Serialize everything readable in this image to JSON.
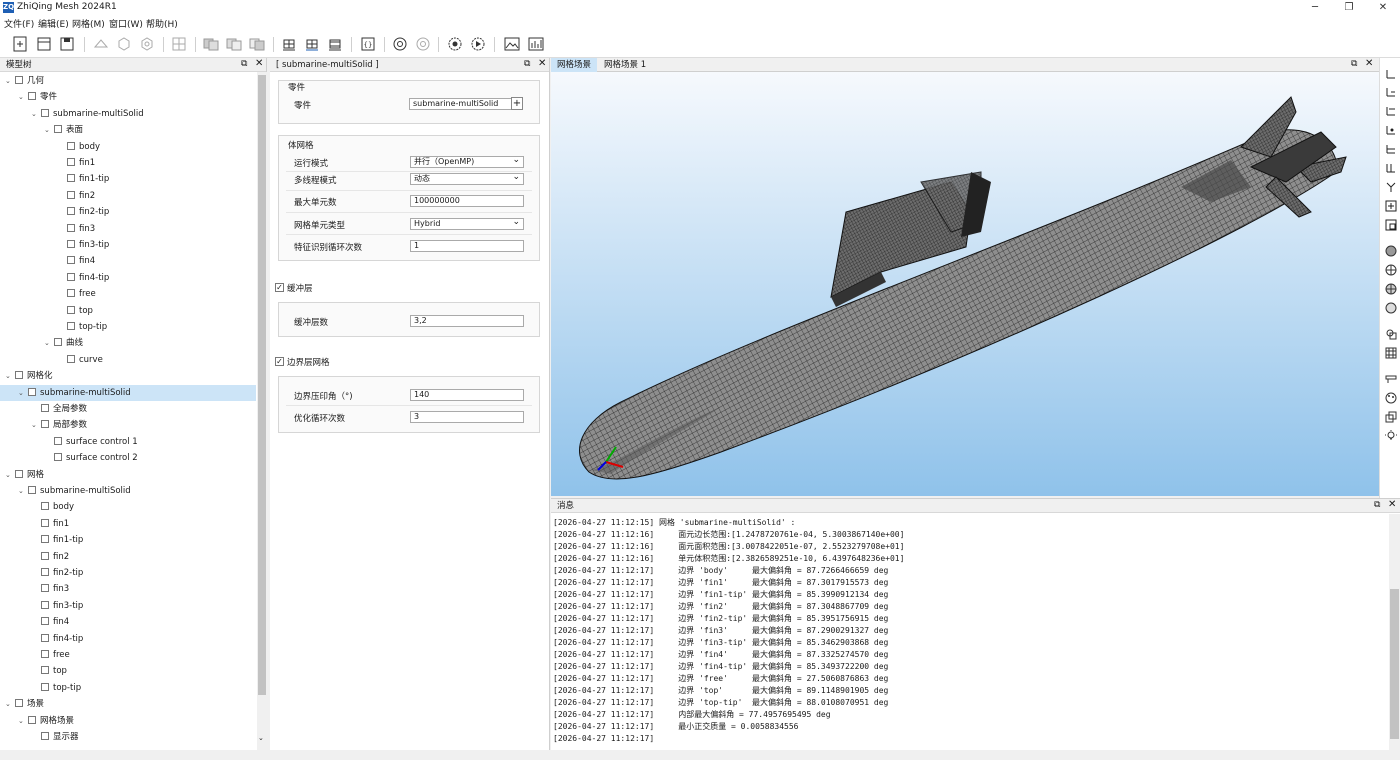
{
  "window": {
    "title": "ZhiQing Mesh 2024R1",
    "logo": "ZQ"
  },
  "menu": [
    "文件(F)",
    "编辑(E)",
    "网格(M)",
    "窗口(W)",
    "帮助(H)"
  ],
  "tree": {
    "title": "模型树",
    "rows": [
      {
        "label": "几何",
        "level": 0,
        "arrow": "⌄"
      },
      {
        "label": "零件",
        "level": 1,
        "arrow": "⌄"
      },
      {
        "label": "submarine-multiSolid",
        "level": 2,
        "arrow": "⌄"
      },
      {
        "label": "表面",
        "level": 3,
        "arrow": "⌄"
      },
      {
        "label": "body",
        "level": 4,
        "arrow": ""
      },
      {
        "label": "fin1",
        "level": 4,
        "arrow": ""
      },
      {
        "label": "fin1-tip",
        "level": 4,
        "arrow": ""
      },
      {
        "label": "fin2",
        "level": 4,
        "arrow": ""
      },
      {
        "label": "fin2-tip",
        "level": 4,
        "arrow": ""
      },
      {
        "label": "fin3",
        "level": 4,
        "arrow": ""
      },
      {
        "label": "fin3-tip",
        "level": 4,
        "arrow": ""
      },
      {
        "label": "fin4",
        "level": 4,
        "arrow": ""
      },
      {
        "label": "fin4-tip",
        "level": 4,
        "arrow": ""
      },
      {
        "label": "free",
        "level": 4,
        "arrow": ""
      },
      {
        "label": "top",
        "level": 4,
        "arrow": ""
      },
      {
        "label": "top-tip",
        "level": 4,
        "arrow": ""
      },
      {
        "label": "曲线",
        "level": 3,
        "arrow": "⌄"
      },
      {
        "label": "curve",
        "level": 4,
        "arrow": ""
      },
      {
        "label": "网格化",
        "level": 0,
        "arrow": "⌄"
      },
      {
        "label": "submarine-multiSolid",
        "level": 1,
        "arrow": "⌄",
        "selected": true
      },
      {
        "label": "全局参数",
        "level": 2,
        "arrow": ""
      },
      {
        "label": "局部参数",
        "level": 2,
        "arrow": "⌄"
      },
      {
        "label": "surface control 1",
        "level": 3,
        "arrow": ""
      },
      {
        "label": "surface control 2",
        "level": 3,
        "arrow": ""
      },
      {
        "label": "网格",
        "level": 0,
        "arrow": "⌄"
      },
      {
        "label": "submarine-multiSolid",
        "level": 1,
        "arrow": "⌄"
      },
      {
        "label": "body",
        "level": 2,
        "arrow": ""
      },
      {
        "label": "fin1",
        "level": 2,
        "arrow": ""
      },
      {
        "label": "fin1-tip",
        "level": 2,
        "arrow": ""
      },
      {
        "label": "fin2",
        "level": 2,
        "arrow": ""
      },
      {
        "label": "fin2-tip",
        "level": 2,
        "arrow": ""
      },
      {
        "label": "fin3",
        "level": 2,
        "arrow": ""
      },
      {
        "label": "fin3-tip",
        "level": 2,
        "arrow": ""
      },
      {
        "label": "fin4",
        "level": 2,
        "arrow": ""
      },
      {
        "label": "fin4-tip",
        "level": 2,
        "arrow": ""
      },
      {
        "label": "free",
        "level": 2,
        "arrow": ""
      },
      {
        "label": "top",
        "level": 2,
        "arrow": ""
      },
      {
        "label": "top-tip",
        "level": 2,
        "arrow": ""
      },
      {
        "label": "场景",
        "level": 0,
        "arrow": "⌄"
      },
      {
        "label": "网格场景",
        "level": 1,
        "arrow": "⌄"
      },
      {
        "label": "显示器",
        "level": 2,
        "arrow": ""
      }
    ]
  },
  "props": {
    "title": "[ submarine-multiSolid ]",
    "part_group": "零件",
    "part_label": "零件",
    "part_value": "submarine-multiSolid",
    "volume_group": "体网格",
    "run_mode_label": "运行模式",
    "run_mode_value": "并行（OpenMP)",
    "thread_mode_label": "多线程模式",
    "thread_mode_value": "动态",
    "max_cells_label": "最大单元数",
    "max_cells_value": "100000000",
    "cell_type_label": "网格单元类型",
    "cell_type_value": "Hybrid",
    "feature_iter_label": "特征识别循环次数",
    "feature_iter_value": "1",
    "buffer_check": "缓冲层",
    "buffer_layers_label": "缓冲层数",
    "buffer_layers_value": "3,2",
    "bl_check": "边界层网格",
    "imprint_angle_label": "边界压印角（°)",
    "imprint_angle_value": "140",
    "opt_iter_label": "优化循环次数",
    "opt_iter_value": "3"
  },
  "view": {
    "tabs": [
      "网格场景",
      "网格场景 1"
    ]
  },
  "messages": {
    "title": "消息",
    "lines": [
      "[2026-04-27 11:12:15] 网格 'submarine-multiSolid' :",
      "[2026-04-27 11:12:16]     面元边长范围:[1.2478720761e-04, 5.3003867140e+00]",
      "[2026-04-27 11:12:16]     面元面积范围:[3.0078422051e-07, 2.5523279708e+01]",
      "[2026-04-27 11:12:16]     单元体积范围:[2.3826589251e-10, 6.4397648236e+01]",
      "[2026-04-27 11:12:17]     边界 'body'     最大偏斜角 = 87.7266466659 deg",
      "[2026-04-27 11:12:17]     边界 'fin1'     最大偏斜角 = 87.3017915573 deg",
      "[2026-04-27 11:12:17]     边界 'fin1-tip' 最大偏斜角 = 85.3990912134 deg",
      "[2026-04-27 11:12:17]     边界 'fin2'     最大偏斜角 = 87.3048867709 deg",
      "[2026-04-27 11:12:17]     边界 'fin2-tip' 最大偏斜角 = 85.3951756915 deg",
      "[2026-04-27 11:12:17]     边界 'fin3'     最大偏斜角 = 87.2900291327 deg",
      "[2026-04-27 11:12:17]     边界 'fin3-tip' 最大偏斜角 = 85.3462903868 deg",
      "[2026-04-27 11:12:17]     边界 'fin4'     最大偏斜角 = 87.3325274570 deg",
      "[2026-04-27 11:12:17]     边界 'fin4-tip' 最大偏斜角 = 85.3493722200 deg",
      "[2026-04-27 11:12:17]     边界 'free'     最大偏斜角 = 27.5060876863 deg",
      "[2026-04-27 11:12:17]     边界 'top'      最大偏斜角 = 89.1148901905 deg",
      "[2026-04-27 11:12:17]     边界 'top-tip'  最大偏斜角 = 88.0108070951 deg",
      "[2026-04-27 11:12:17]     内部最大偏斜角 = 77.4957695495 deg",
      "[2026-04-27 11:12:17]     最小正交质量 = 0.0058834556",
      "[2026-04-27 11:12:17]"
    ]
  },
  "colors": {
    "selection": "#cce4f7",
    "sky_top": "#f6f9fd",
    "sky_bottom": "#8fc2ea",
    "accent": "#1e5fb4"
  }
}
